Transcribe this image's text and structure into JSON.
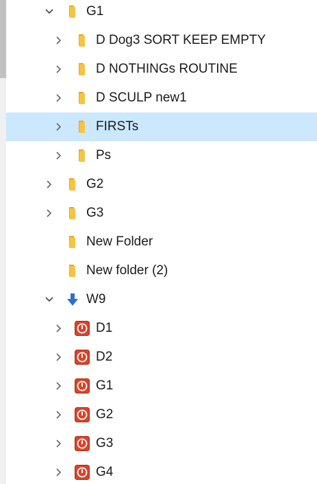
{
  "tree": {
    "rows": [
      {
        "label": "G1",
        "icon": "folder-icon",
        "expander": "chevron-down-icon"
      },
      {
        "label": "D Dog3 SORT KEEP EMPTY",
        "icon": "folder-icon",
        "expander": "chevron-right-icon"
      },
      {
        "label": "D NOTHINGs ROUTINE",
        "icon": "folder-icon",
        "expander": "chevron-right-icon"
      },
      {
        "label": "D SCULP new1",
        "icon": "folder-icon",
        "expander": "chevron-right-icon"
      },
      {
        "label": "FIRSTs",
        "icon": "folder-icon",
        "expander": "chevron-right-icon",
        "selected": true
      },
      {
        "label": "Ps",
        "icon": "folder-icon",
        "expander": "chevron-right-icon"
      },
      {
        "label": "G2",
        "icon": "folder-icon",
        "expander": "chevron-right-icon"
      },
      {
        "label": "G3",
        "icon": "folder-icon",
        "expander": "chevron-right-icon"
      },
      {
        "label": "New Folder",
        "icon": "folder-icon",
        "expander": "none"
      },
      {
        "label": "New folder (2)",
        "icon": "folder-icon",
        "expander": "none"
      },
      {
        "label": "W9",
        "icon": "download-arrow-icon",
        "expander": "chevron-down-icon"
      },
      {
        "label": "D1",
        "icon": "power-icon",
        "expander": "chevron-right-icon"
      },
      {
        "label": "D2",
        "icon": "power-icon",
        "expander": "chevron-right-icon"
      },
      {
        "label": "G1",
        "icon": "power-icon",
        "expander": "chevron-right-icon"
      },
      {
        "label": "G2",
        "icon": "power-icon",
        "expander": "chevron-right-icon"
      },
      {
        "label": "G3",
        "icon": "power-icon",
        "expander": "chevron-right-icon"
      },
      {
        "label": "G4",
        "icon": "power-icon",
        "expander": "chevron-right-icon"
      }
    ]
  },
  "colors": {
    "selection": "#cce8ff",
    "folder": "#f5c542",
    "download_arrow": "#2f6fd1",
    "power_badge": "#d9442a"
  }
}
